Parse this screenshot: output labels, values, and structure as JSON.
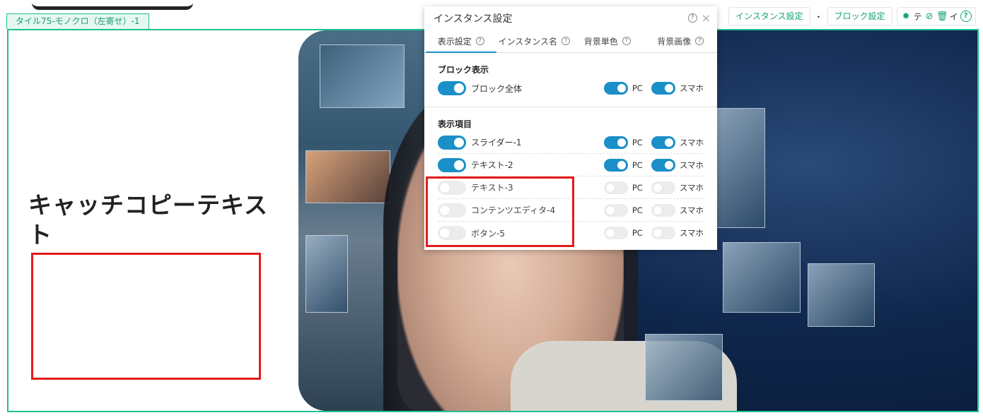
{
  "block_label": "タイル75-モノクロ（左寄せ）-1",
  "catch_copy": "キャッチコピーテキスト",
  "toolbar": {
    "instance_settings": "インスタンス設定",
    "block_settings": "ブロック設定",
    "separator": "・",
    "trailing_text_1": "テ",
    "trailing_text_2": "イ",
    "icons": [
      "gear-icon",
      "eye-off-icon",
      "trash-icon",
      "help-icon"
    ]
  },
  "panel": {
    "title": "インスタンス設定",
    "tabs": [
      {
        "label": "表示設定"
      },
      {
        "label": "インスタンス名"
      },
      {
        "label": "背景単色"
      },
      {
        "label": "背景画像"
      }
    ],
    "block_display": {
      "title": "ブロック表示",
      "row": {
        "label": "ブロック全体",
        "enabled": true,
        "pc": true,
        "sp": true
      }
    },
    "items_section": {
      "title": "表示項目",
      "rows": [
        {
          "label": "スライダー-1",
          "enabled": true,
          "pc": true,
          "sp": true
        },
        {
          "label": "テキスト-2",
          "enabled": true,
          "pc": true,
          "sp": true
        },
        {
          "label": "テキスト-3",
          "enabled": false,
          "pc": false,
          "sp": false
        },
        {
          "label": "コンテンツエディタ-4",
          "enabled": false,
          "pc": false,
          "sp": false
        },
        {
          "label": "ボタン-5",
          "enabled": false,
          "pc": false,
          "sp": false
        }
      ]
    },
    "pc_label": "PC",
    "sp_label": "スマホ"
  },
  "colors": {
    "accent_blue": "#1a8fc8",
    "accent_green": "#20c093",
    "highlight_red": "#e21b1b"
  }
}
